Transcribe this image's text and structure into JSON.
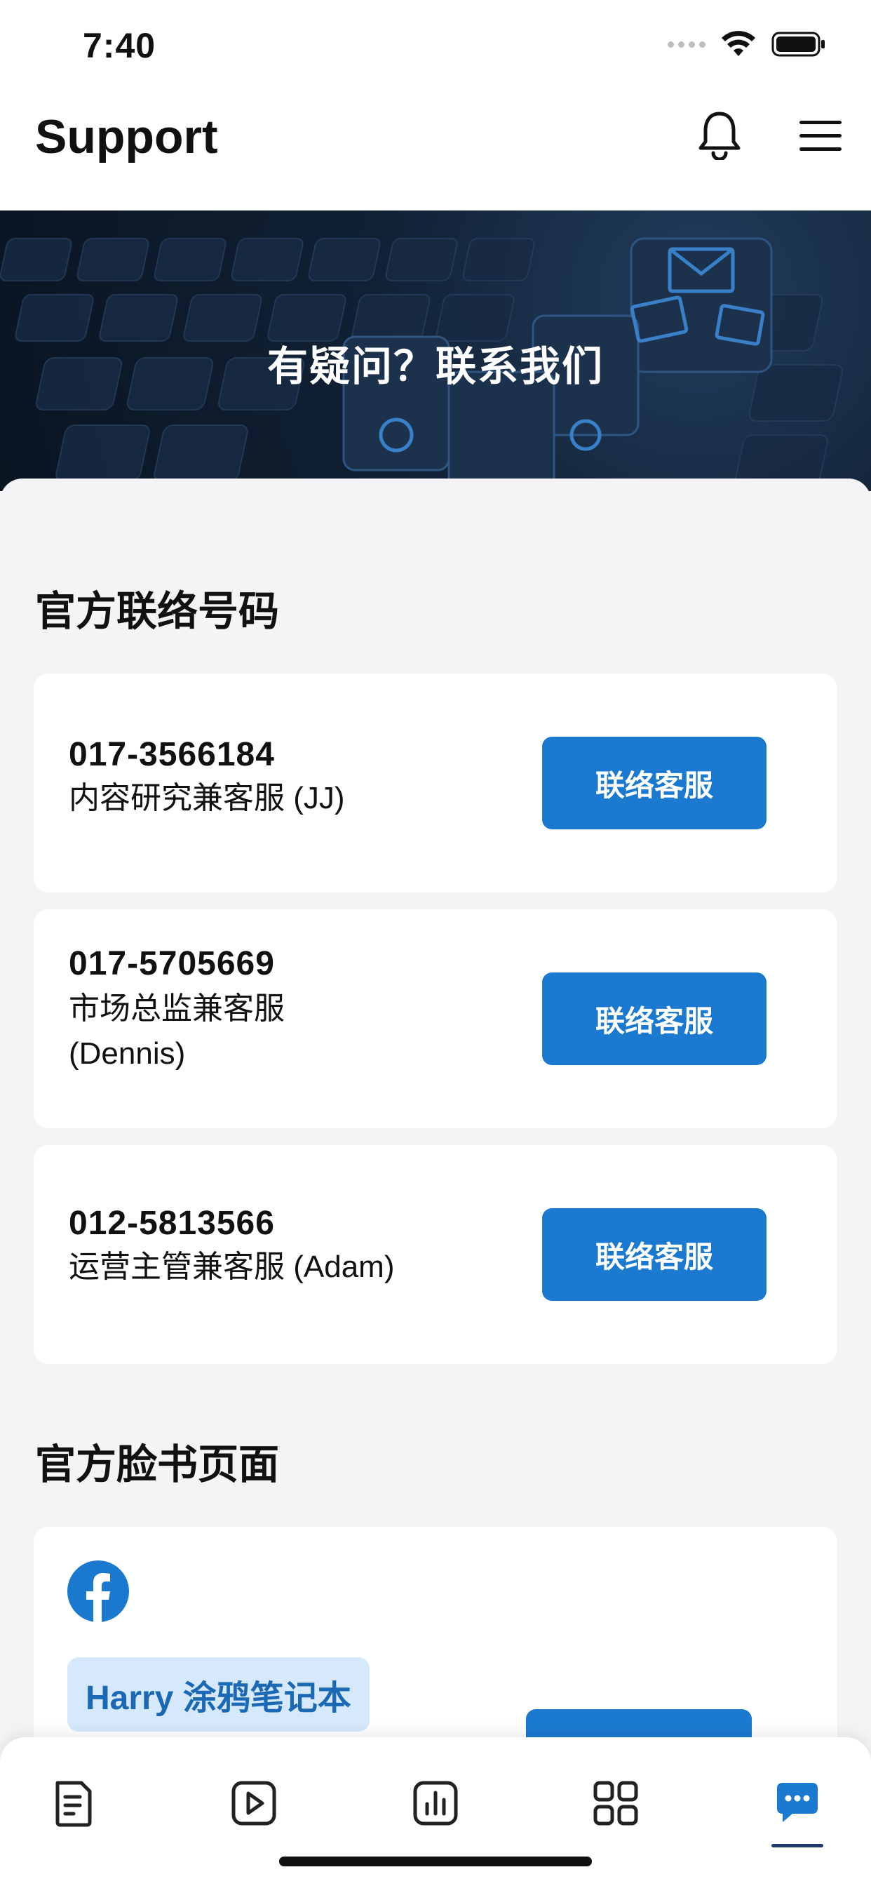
{
  "status_bar": {
    "time": "7:40"
  },
  "header": {
    "title": "Support",
    "icons": [
      "bell-icon",
      "hamburger-menu-icon"
    ]
  },
  "hero": {
    "title": "有疑问？联系我们"
  },
  "sections": {
    "phones_title": "官方联络号码",
    "facebook_title": "官方脸书页面"
  },
  "contacts": [
    {
      "phone": "017-3566184",
      "role": "内容研究兼客服 (JJ)",
      "button": "联络客服"
    },
    {
      "phone": "017-5705669",
      "role": "市场总监兼客服 (Dennis)",
      "button": "联络客服"
    },
    {
      "phone": "012-5813566",
      "role": "运营主管兼客服 (Adam)",
      "button": "联络客服"
    }
  ],
  "facebook": {
    "icon": "facebook-icon",
    "page_name": "Harry 涂鸦笔记本"
  },
  "bottom_nav": {
    "items": [
      "notes-icon",
      "video-play-icon",
      "bar-chart-icon",
      "grid-icon",
      "chat-support-icon"
    ],
    "active_index": 4
  },
  "colors": {
    "accent": "#1b7ad0",
    "badge_bg": "#d6e8fb",
    "badge_text": "#1b68b5",
    "nav_active": "#1f3a6b"
  }
}
